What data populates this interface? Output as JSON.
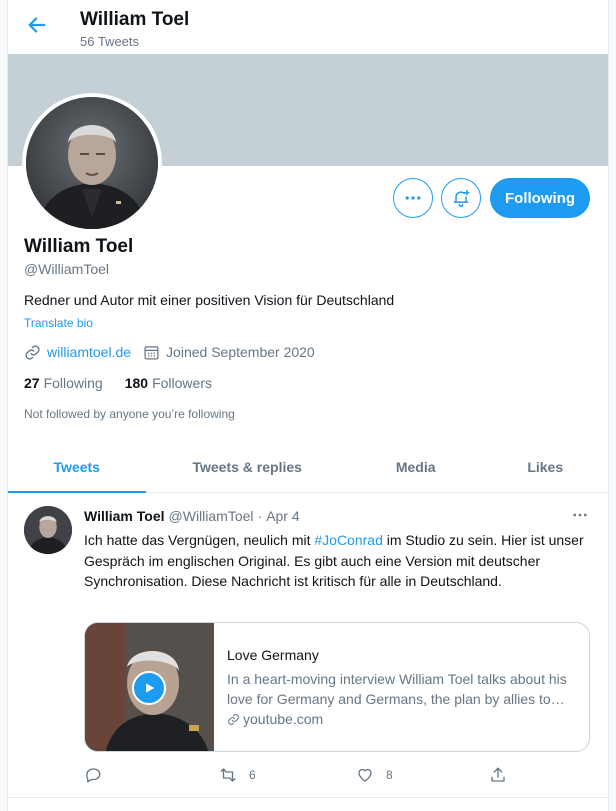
{
  "header": {
    "name": "William Toel",
    "tweet_count": "56 Tweets"
  },
  "profile": {
    "name": "William Toel",
    "handle": "@WilliamToel",
    "bio": "Redner und Autor mit einer positiven Vision für Deutschland",
    "translate_label": "Translate bio",
    "website": "williamtoel.de",
    "joined": "Joined September 2020",
    "following_count": "27",
    "following_label": "Following",
    "followers_count": "180",
    "followers_label": "Followers",
    "not_followed_text": "Not followed by anyone you’re following",
    "follow_button_label": "Following"
  },
  "tabs": [
    {
      "label": "Tweets",
      "active": true
    },
    {
      "label": "Tweets & replies",
      "active": false
    },
    {
      "label": "Media",
      "active": false
    },
    {
      "label": "Likes",
      "active": false
    }
  ],
  "tweet": {
    "name": "William Toel",
    "handle": "@WilliamToel",
    "dot": "·",
    "date": "Apr 4",
    "text_before": "Ich hatte das Vergnügen, neulich mit ",
    "hashtag": "#JoConrad",
    "text_after": " im Studio zu sein.  Hier ist unser Gespräch im englischen Original.  Es gibt auch eine Version mit deutscher Synchronisation.   Diese Nachricht ist kritisch für alle in Deutschland.",
    "card": {
      "title": "Love Germany",
      "description": "In a heart-moving interview William Toel talks about his love for Germany and Germans, the plan by allies to destroy Germany and how Germans can take their country back.",
      "domain": "youtube.com"
    },
    "retweet_count": "6",
    "like_count": "8"
  },
  "icons": {
    "back": "arrow-left-icon",
    "more": "more-horizontal-icon",
    "notifications": "bell-plus-icon",
    "link": "link-icon",
    "calendar": "calendar-icon",
    "reply": "reply-icon",
    "retweet": "retweet-icon",
    "like": "heart-icon",
    "share": "share-icon",
    "play": "play-icon"
  },
  "colors": {
    "accent": "#1d9bf0",
    "banner": "#c4cfd6",
    "secondary_text": "#657786"
  }
}
